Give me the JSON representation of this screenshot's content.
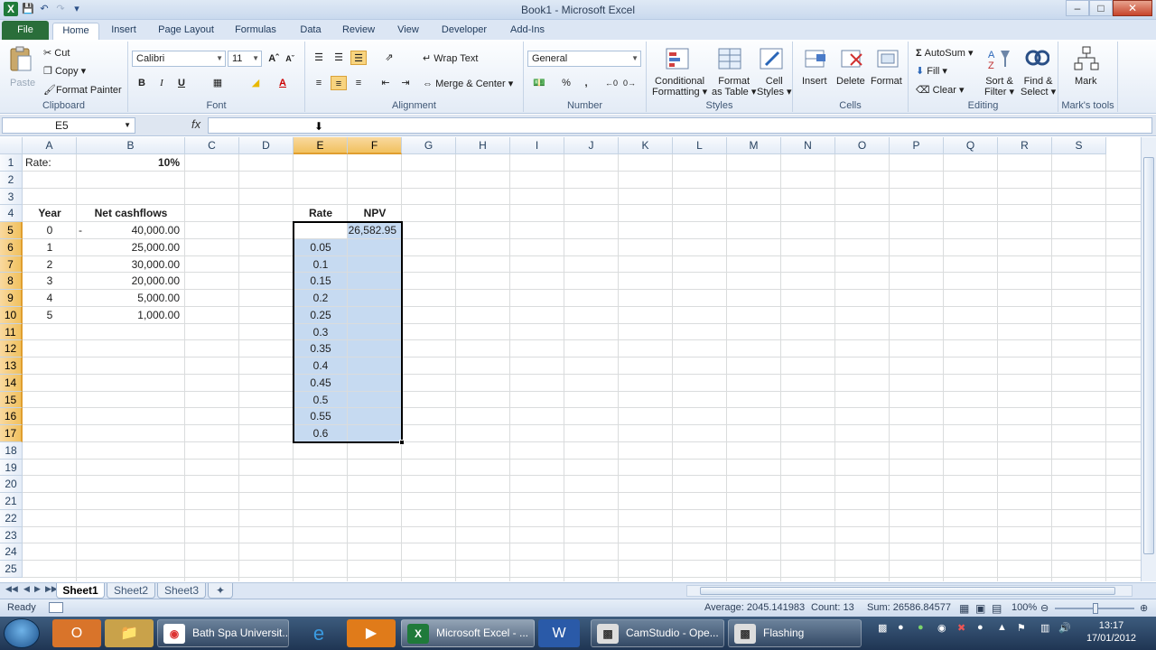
{
  "window": {
    "title": "Book1  -  Microsoft Excel"
  },
  "tabs": [
    "File",
    "Home",
    "Insert",
    "Page Layout",
    "Formulas",
    "Data",
    "Review",
    "View",
    "Developer",
    "Add-Ins"
  ],
  "ribbon": {
    "clipboard": {
      "paste": "Paste",
      "cut": "Cut",
      "copy": "Copy",
      "format_painter": "Format Painter",
      "label": "Clipboard"
    },
    "font": {
      "name": "Calibri",
      "size": "11",
      "label": "Font"
    },
    "alignment": {
      "wrap_text": "Wrap Text",
      "merge_center": "Merge & Center",
      "label": "Alignment"
    },
    "number": {
      "format": "General",
      "percent": "%",
      "comma": ",",
      "label": "Number"
    },
    "styles": {
      "conditional": "Conditional",
      "conditional2": "Formatting",
      "format_as": "Format",
      "format_as2": "as Table",
      "cell": "Cell",
      "cell2": "Styles",
      "label": "Styles"
    },
    "cells": {
      "insert": "Insert",
      "delete": "Delete",
      "format": "Format",
      "label": "Cells"
    },
    "editing": {
      "autosum": "AutoSum",
      "fill": "Fill",
      "clear": "Clear",
      "sort": "Sort &",
      "sort2": "Filter",
      "find": "Find &",
      "find2": "Select",
      "label": "Editing"
    },
    "marks": {
      "mark": "Mark",
      "label": "Mark's tools"
    }
  },
  "formula_bar": {
    "name_box": "E5",
    "fx": "fx",
    "formula": ""
  },
  "columns": [
    "A",
    "B",
    "C",
    "D",
    "E",
    "F",
    "G",
    "H",
    "I",
    "J",
    "K",
    "L",
    "M",
    "N",
    "O",
    "P",
    "Q",
    "R",
    "S"
  ],
  "rows": [
    "1",
    "2",
    "3",
    "4",
    "5",
    "6",
    "7",
    "8",
    "9",
    "10",
    "11",
    "12",
    "13",
    "14",
    "15",
    "16",
    "17",
    "18",
    "19",
    "20",
    "21",
    "22",
    "23",
    "24",
    "25"
  ],
  "cells": {
    "A1": "Rate:",
    "B1": "10%",
    "A4": "Year",
    "B4": "Net cashflows",
    "A5": "0",
    "A5b": "-",
    "B5": "40,000.00",
    "A6": "1",
    "B6": "25,000.00",
    "A7": "2",
    "B7": "30,000.00",
    "A8": "3",
    "B8": "20,000.00",
    "A9": "4",
    "B9": "5,000.00",
    "A10": "5",
    "B10": "1,000.00",
    "E4": "Rate",
    "F4": "NPV",
    "F5": "26,582.95",
    "E6": "0.05",
    "E7": "0.1",
    "E8": "0.15",
    "E9": "0.2",
    "E10": "0.25",
    "E11": "0.3",
    "E12": "0.35",
    "E13": "0.4",
    "E14": "0.45",
    "E15": "0.5",
    "E16": "0.55",
    "E17": "0.6"
  },
  "sheets": [
    "Sheet1",
    "Sheet2",
    "Sheet3"
  ],
  "status": {
    "ready": "Ready",
    "average": "Average: 2045.141983",
    "count": "Count: 13",
    "sum": "Sum: 26586.84577",
    "zoom": "100%"
  },
  "taskbar": {
    "tasks": [
      "Bath Spa Universit...",
      "Microsoft Excel - ...",
      "CamStudio - Ope...",
      "Flashing"
    ],
    "time": "13:17",
    "date": "17/01/2012"
  }
}
